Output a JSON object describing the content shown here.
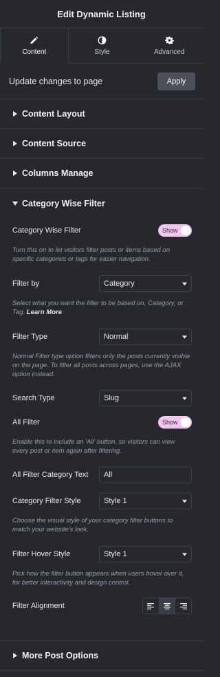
{
  "header": {
    "title": "Edit Dynamic Listing"
  },
  "tabs": [
    {
      "label": "Content",
      "icon": "pencil-icon",
      "active": true
    },
    {
      "label": "Style",
      "icon": "contrast-icon",
      "active": false
    },
    {
      "label": "Advanced",
      "icon": "gear-icon",
      "active": false
    }
  ],
  "update": {
    "label": "Update changes to page",
    "button": "Apply"
  },
  "sections_top": [
    {
      "title": "Content Layout"
    },
    {
      "title": "Content Source"
    },
    {
      "title": "Columns Manage"
    }
  ],
  "category_filter": {
    "title": "Category Wise Filter",
    "wise_filter_label": "Category Wise Filter",
    "wise_filter_toggle": "Show",
    "wise_filter_desc": "Turn this on to let visitors filter posts or items based on specific categories or tags for easier navigation.",
    "filter_by_label": "Filter by",
    "filter_by_value": "Category",
    "filter_by_desc": "Select what you want the filter to be based on, Category, or Tag.",
    "filter_by_link": "Learn More",
    "filter_type_label": "Filter Type",
    "filter_type_value": "Normal",
    "filter_type_desc": "Normal Filter type option filters only the posts currently visible on the page. To filter all posts across pages, use the AJAX option instead.",
    "search_type_label": "Search Type",
    "search_type_value": "Slug",
    "all_filter_label": "All Filter",
    "all_filter_toggle": "Show",
    "all_filter_desc": "Enable this to include an 'All' button, so visitors can view every post or item again after filtering.",
    "all_filter_text_label": "All Filter Category Text",
    "all_filter_text_value": "All",
    "cat_style_label": "Category Filter Style",
    "cat_style_value": "Style 1",
    "cat_style_desc": "Choose the visual style of your category filter buttons to match your website's look.",
    "hover_style_label": "Filter Hover Style",
    "hover_style_value": "Style 1",
    "hover_style_desc": "Pick how the filter button appears when users hover over it, for better interactivity and design control.",
    "alignment_label": "Filter Alignment",
    "alignment_options": [
      "align-left-icon",
      "align-center-icon",
      "align-right-icon"
    ],
    "alignment_selected": "center"
  },
  "sections_bottom": [
    {
      "title": "More Post Options"
    }
  ],
  "colors": {
    "background": "#26282d",
    "toggle_on": "#f3c5f0",
    "divider": "#3a3d44"
  }
}
